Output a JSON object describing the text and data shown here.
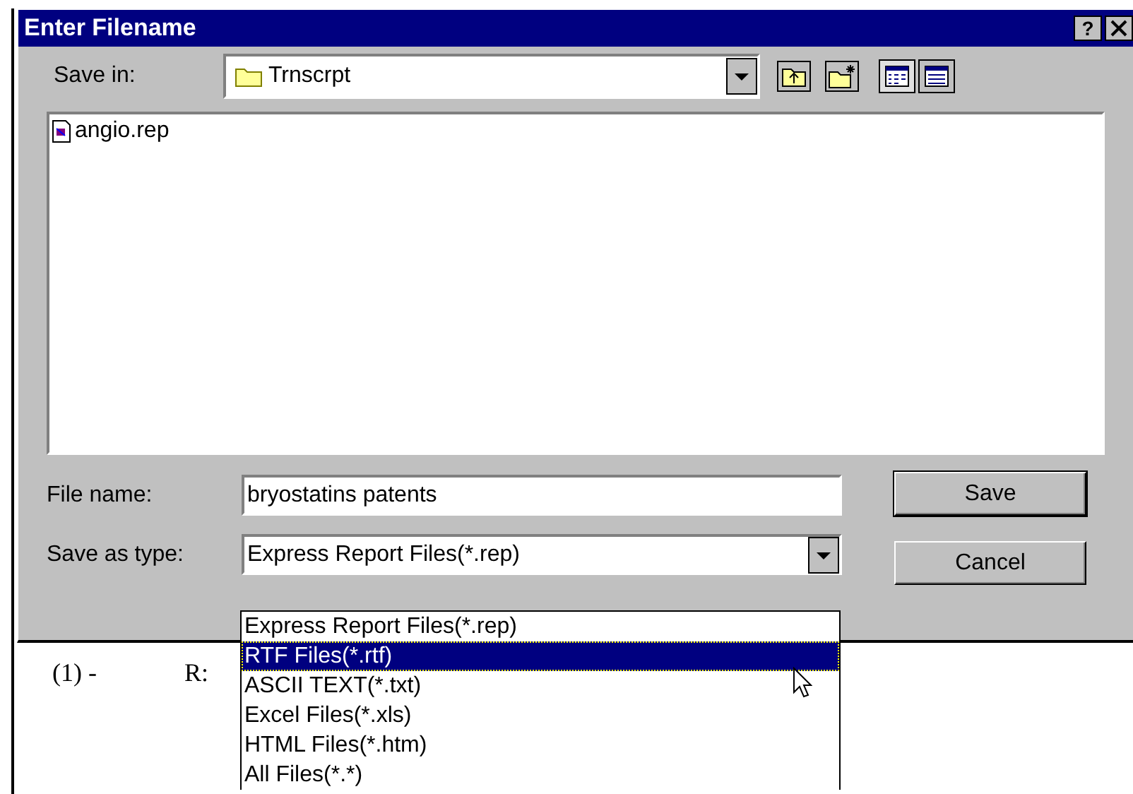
{
  "window": {
    "title": "Enter Filename",
    "help_button": "?"
  },
  "save_in": {
    "label": "Save in:",
    "folder": "Trnscrpt"
  },
  "files": [
    {
      "name": "angio.rep"
    }
  ],
  "file_name": {
    "label": "File name:",
    "value": "bryostatins patents"
  },
  "save_as_type": {
    "label": "Save as type:",
    "value": "Express Report Files(*.rep)",
    "expanded": true,
    "options": [
      {
        "label": "Express Report Files(*.rep)",
        "highlighted": false
      },
      {
        "label": "RTF Files(*.rtf)",
        "highlighted": true
      },
      {
        "label": "ASCII TEXT(*.txt)",
        "highlighted": false
      },
      {
        "label": "Excel Files(*.xls)",
        "highlighted": false
      },
      {
        "label": "HTML Files(*.htm)",
        "highlighted": false
      },
      {
        "label": "All Files(*.*)",
        "highlighted": false
      }
    ]
  },
  "buttons": [
    "Save",
    "Cancel"
  ],
  "document": {
    "texts": [
      "(1) -",
      "R:"
    ]
  }
}
